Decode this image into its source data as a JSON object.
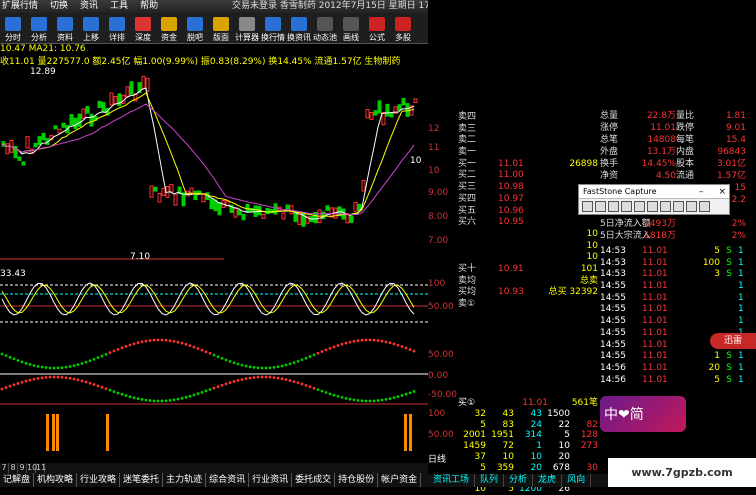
{
  "menu": [
    "扩展行情",
    "切换",
    "资讯",
    "工具",
    "帮助"
  ],
  "title": "交易未登录  香雪制药  2012年7月15日 星期日 17",
  "toolbar": [
    {
      "label": "分时",
      "color": "#2a6fd6"
    },
    {
      "label": "分析",
      "color": "#2a6fd6"
    },
    {
      "label": "资料",
      "color": "#2a6fd6"
    },
    {
      "label": "上移",
      "color": "#2a6fd6"
    },
    {
      "label": "详排",
      "color": "#2a6fd6"
    },
    {
      "label": "深度",
      "color": "#d33"
    },
    {
      "label": "资金",
      "color": "#d9a400"
    },
    {
      "label": "脱吧",
      "color": "#2a6fd6"
    },
    {
      "label": "版面",
      "color": "#d9a400"
    },
    {
      "label": "计算器",
      "color": "#888"
    },
    {
      "label": "换行情",
      "color": "#2a6fd6"
    },
    {
      "label": "换资讯",
      "color": "#2a6fd6"
    },
    {
      "label": "动态池",
      "color": "#555"
    },
    {
      "label": "画线",
      "color": "#555"
    },
    {
      "label": "公式",
      "color": "#c22"
    },
    {
      "label": "多股",
      "color": "#c22"
    }
  ],
  "chart": {
    "ma_line": "10.47  MA21: 10.76",
    "info_line": "收11.01 量227577.0 额2.45亿 幅1.00(9.99%) 振0.83(8.29%) 换14.45% 流通1.57亿 生物制药",
    "high_label": "12.89",
    "low_label": "7.10",
    "current_label": "10",
    "macd_label": "33.43",
    "axis": [
      "12",
      "11",
      "10",
      "9.00",
      "8.00",
      "7.00",
      "100",
      "50.00",
      "50.00",
      "0.00",
      "-50.00",
      "100",
      "50.00"
    ],
    "period": "日线",
    "current_price_label": "10.93"
  },
  "quotes": [
    {
      "label": "卖四",
      "price": "",
      "vol": ""
    },
    {
      "label": "卖三",
      "price": "",
      "vol": ""
    },
    {
      "label": "卖二",
      "price": "",
      "vol": ""
    },
    {
      "label": "卖一",
      "price": "",
      "vol": ""
    },
    {
      "label": "买一",
      "price": "11.01",
      "vol": "26898"
    },
    {
      "label": "买二",
      "price": "11.00",
      "vol": ""
    },
    {
      "label": "买三",
      "price": "10.98",
      "vol": ""
    },
    {
      "label": "买四",
      "price": "10.97",
      "vol": ""
    },
    {
      "label": "买五",
      "price": "10.96",
      "vol": ""
    },
    {
      "label": "买六",
      "price": "10.95",
      "vol": ""
    },
    {
      "label": "",
      "price": "",
      "vol": "10"
    },
    {
      "label": "",
      "price": "",
      "vol": "10"
    },
    {
      "label": "",
      "price": "",
      "vol": "10"
    },
    {
      "label": "买十",
      "price": "10.91",
      "vol": "101"
    },
    {
      "label": "卖均",
      "price": "",
      "vol": "总卖"
    },
    {
      "label": "买均",
      "price": "10.93",
      "vol": "总买 32392"
    },
    {
      "label": "卖①",
      "price": "",
      "vol": ""
    }
  ],
  "stats": [
    {
      "k": "总量",
      "v": "22.8万",
      "k2": "量比",
      "v2": "1.81"
    },
    {
      "k": "涨停",
      "v": "11.01",
      "k2": "跌停",
      "v2": "9.01"
    },
    {
      "k": "总笔",
      "v": "14808",
      "k2": "每笔",
      "v2": "15.4"
    },
    {
      "k": "外盘",
      "v": "13.1万",
      "k2": "内盘",
      "v2": "96843"
    },
    {
      "k": "换手",
      "v": "14.45%",
      "k2": "股本",
      "v2": "3.01亿"
    },
    {
      "k": "净资",
      "v": "4.50",
      "k2": "流通",
      "v2": "1.57亿"
    },
    {
      "k": "",
      "v": "",
      "k2": "",
      "v2": "15"
    },
    {
      "k": "",
      "v": "",
      "k2": "",
      "v2": "2.2"
    },
    {
      "k": "大宗流入",
      "v": "",
      "k2": "",
      "v2": ""
    },
    {
      "k": "5日净流入额",
      "v": "1493万",
      "k2": "",
      "v2": "2%"
    },
    {
      "k": "5日大宗流入",
      "v": "1818万",
      "k2": "",
      "v2": "2%"
    }
  ],
  "trades": [
    {
      "t": "14:53",
      "p": "11.01",
      "v": "5",
      "d": "S",
      "n": "1"
    },
    {
      "t": "14:53",
      "p": "11.01",
      "v": "100",
      "d": "S",
      "n": "1"
    },
    {
      "t": "14:53",
      "p": "11.01",
      "v": "3",
      "d": "S",
      "n": "1"
    },
    {
      "t": "14:55",
      "p": "11.01",
      "v": "",
      "d": "",
      "n": "1"
    },
    {
      "t": "14:55",
      "p": "11.01",
      "v": "",
      "d": "",
      "n": "1"
    },
    {
      "t": "14:55",
      "p": "11.01",
      "v": "",
      "d": "",
      "n": "1"
    },
    {
      "t": "14:55",
      "p": "11.01",
      "v": "",
      "d": "",
      "n": "1"
    },
    {
      "t": "14:55",
      "p": "11.01",
      "v": "",
      "d": "",
      "n": "1"
    },
    {
      "t": "14:55",
      "p": "11.01",
      "v": "5",
      "d": "S",
      "n": "1"
    },
    {
      "t": "14:55",
      "p": "11.01",
      "v": "1",
      "d": "S",
      "n": "1"
    },
    {
      "t": "14:56",
      "p": "11.01",
      "v": "20",
      "d": "S",
      "n": "1"
    },
    {
      "t": "14:56",
      "p": "11.01",
      "v": "5",
      "d": "S",
      "n": "1"
    }
  ],
  "vol_header": {
    "label": "买①",
    "price": "11.01",
    "vol": "561笔"
  },
  "vol_rows": [
    [
      "32",
      "43",
      "43",
      "1500"
    ],
    [
      "5",
      "83",
      "24",
      "22",
      "82"
    ],
    [
      "2001",
      "1951",
      "314",
      "5",
      "128"
    ],
    [
      "1459",
      "72",
      "1",
      "10",
      "273"
    ],
    [
      "37",
      "10",
      "10",
      "20"
    ],
    [
      "5",
      "359",
      "20",
      "678",
      "30"
    ],
    [
      "10",
      "10",
      "10",
      "58"
    ],
    [
      "10",
      "5",
      "1200",
      "26"
    ]
  ],
  "fsc_title": "FastStone Capture",
  "logo_text": "中❤简",
  "side_badge": "迅雷",
  "watermark": "www.7gpzb.com",
  "bottom_nums": [
    "7",
    "8",
    "9",
    "10",
    "11"
  ],
  "bottom_tabs": [
    "记解盘",
    "机构攻略",
    "行业攻略",
    "迷笔委托",
    "主力轨迹",
    "综合资讯",
    "行业资讯",
    "委托成交",
    "持仓股份",
    "帐户资金"
  ],
  "right_tabs": [
    "资讯工场",
    "队列",
    "分析",
    "龙虎",
    "风向"
  ],
  "colors": {
    "up": "#ff3333",
    "down": "#00cc00",
    "ma5": "#ffffff",
    "ma10": "#ffff00",
    "ma20": "#cc44cc"
  }
}
